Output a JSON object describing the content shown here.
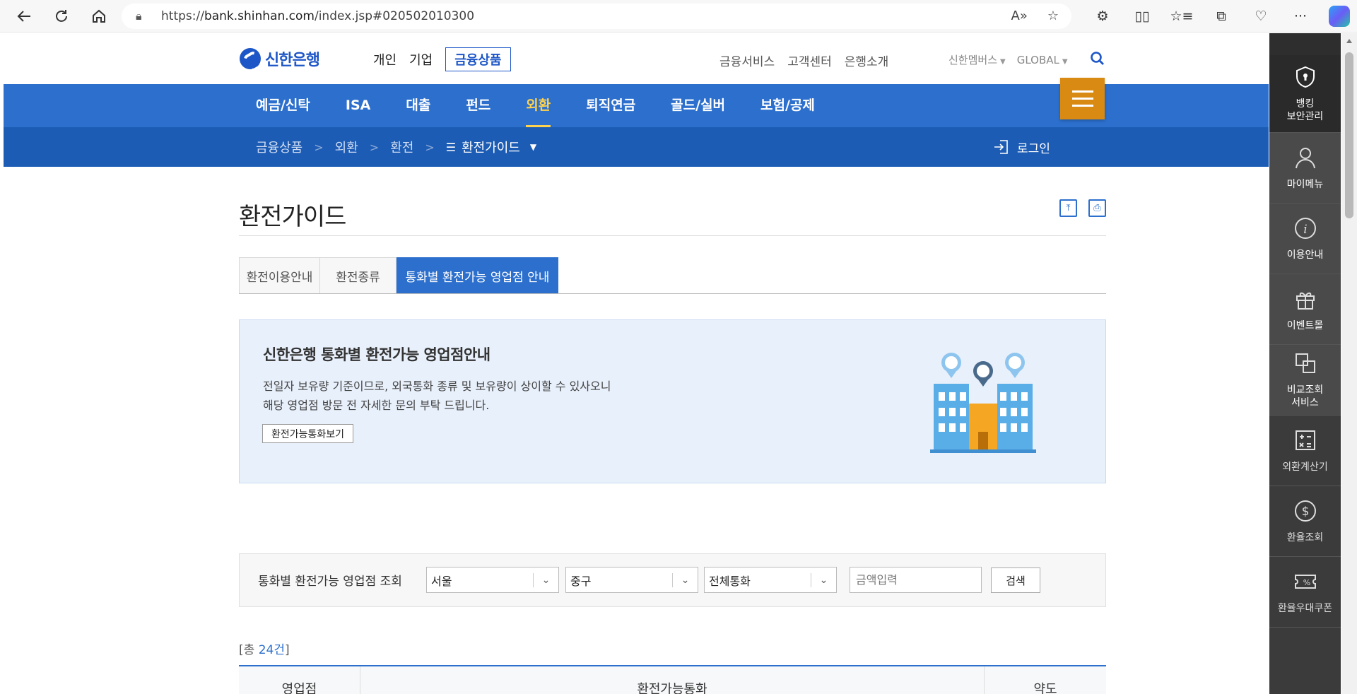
{
  "browser": {
    "url_prefix": "https://",
    "url_host": "bank.shinhan.com",
    "url_path": "/index.jsp#020502010300"
  },
  "header": {
    "logo_text": "신한은행",
    "top_tabs": [
      "개인",
      "기업",
      "금융상품"
    ],
    "util_links": [
      "금융서비스",
      "고객센터",
      "은행소개"
    ],
    "member": "신한멤버스",
    "global": "GLOBAL"
  },
  "lnb": {
    "items": [
      "예금/신탁",
      "ISA",
      "대출",
      "펀드",
      "외환",
      "퇴직연금",
      "골드/실버",
      "보험/공제"
    ],
    "active": "외환"
  },
  "breadcrumb": {
    "items": [
      "금융상품",
      "외환",
      "환전"
    ],
    "current": "환전가이드",
    "login": "로그인"
  },
  "page": {
    "title": "환전가이드",
    "tabs": [
      "환전이용안내",
      "환전종류",
      "통화별 환전가능 영업점 안내"
    ]
  },
  "info": {
    "title": "신한은행 통화별 환전가능 영업점안내",
    "desc_line1": "전일자 보유량 기준이므로, 외국통화 종류 및 보유량이 상이할 수 있사오니",
    "desc_line2": "해당 영업점 방문 전 자세한 문의 부탁 드립니다.",
    "button": "환전가능통화보기"
  },
  "search": {
    "label": "통화별 환전가능 영업점 조회",
    "region": "서울",
    "district": "중구",
    "currency": "전체통화",
    "amount_placeholder": "금액입력",
    "button": "검색"
  },
  "results": {
    "total_prefix": "[총 ",
    "total_count": "24건",
    "total_suffix": "]",
    "columns": [
      "영업점",
      "환전가능통화",
      "약도"
    ]
  },
  "quick_menu": [
    {
      "label1": "뱅킹",
      "label2": "보안관리"
    },
    {
      "label1": "마이메뉴",
      "label2": ""
    },
    {
      "label1": "이용안내",
      "label2": ""
    },
    {
      "label1": "이벤트몰",
      "label2": ""
    },
    {
      "label1": "비교조회",
      "label2": "서비스"
    },
    {
      "label1": "외환계산기",
      "label2": ""
    },
    {
      "label1": "환율조회",
      "label2": ""
    },
    {
      "label1": "환율우대쿠폰",
      "label2": ""
    }
  ],
  "colors": {
    "brand_blue": "#2c6fcd",
    "breadcrumb_blue": "#1c5cb5",
    "menu_orange": "#d98a12",
    "active_yellow": "#ffd34d"
  }
}
